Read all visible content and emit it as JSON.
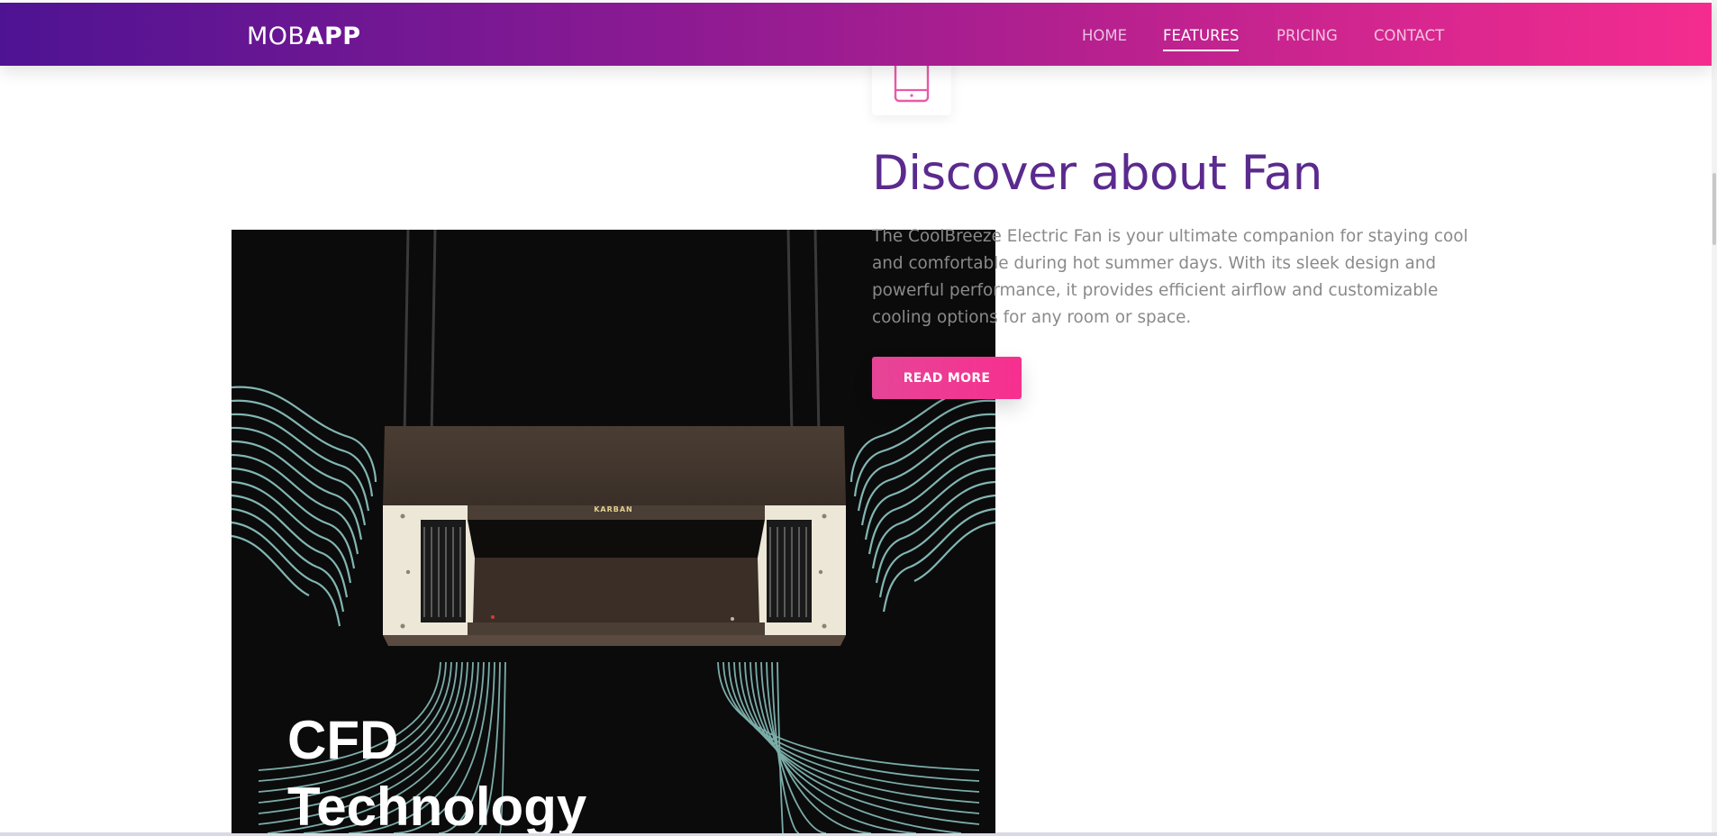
{
  "navbar": {
    "brand_light": "MOB",
    "brand_bold": "APP",
    "links": [
      {
        "label": "HOME"
      },
      {
        "label": "FEATURES",
        "active": true
      },
      {
        "label": "PRICING"
      },
      {
        "label": "CONTACT"
      }
    ]
  },
  "feature": {
    "icon": "tablet-icon",
    "title": "Discover about Fan",
    "description": "The CoolBreeze Electric Fan is your ultimate companion for staying cool and comfortable during hot summer days. With its sleek design and powerful performance, it provides efficient airflow and customizable cooling options for any room or space.",
    "button_label": "READ MORE"
  },
  "image": {
    "caption_text": "CFD\nTechnology",
    "brand_mark": "KARBAN"
  },
  "colors": {
    "nav_gradient_start": "#4e1393",
    "nav_gradient_end": "#f52c8f",
    "title_color": "#5b2a8e",
    "button_color": "#f72f8e",
    "icon_color": "#e85aa8"
  }
}
